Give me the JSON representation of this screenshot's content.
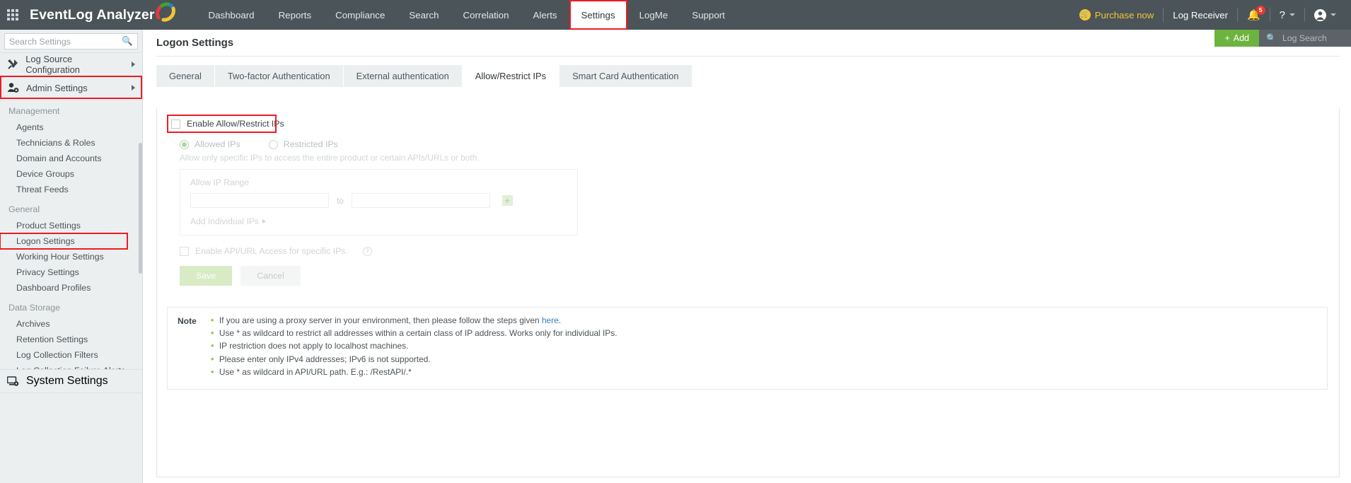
{
  "topbar": {
    "brand": "EventLog Analyzer",
    "apps_icon": "grid-apps-icon",
    "nav": [
      {
        "label": "Dashboard",
        "active": false
      },
      {
        "label": "Reports",
        "active": false
      },
      {
        "label": "Compliance",
        "active": false
      },
      {
        "label": "Search",
        "active": false
      },
      {
        "label": "Correlation",
        "active": false
      },
      {
        "label": "Alerts",
        "active": false
      },
      {
        "label": "Settings",
        "active": true
      },
      {
        "label": "LogMe",
        "active": false
      },
      {
        "label": "Support",
        "active": false
      }
    ],
    "purchase_now": "Purchase now",
    "log_receiver": "Log Receiver",
    "notification_count": "5",
    "help_glyph": "?",
    "add_label": "Add",
    "add_plus": "+",
    "log_search_placeholder": "Log Search"
  },
  "sidebar": {
    "search_placeholder": "Search Settings",
    "search_value": "",
    "top_items": [
      {
        "label": "Log Source Configuration",
        "icon": "tools-icon",
        "highlight": false
      },
      {
        "label": "Admin Settings",
        "icon": "user-gear-icon",
        "highlight": true
      }
    ],
    "groups": [
      {
        "title": "Management",
        "items": [
          {
            "label": "Agents",
            "highlight": false
          },
          {
            "label": "Technicians & Roles",
            "highlight": false
          },
          {
            "label": "Domain and Accounts",
            "highlight": false
          },
          {
            "label": "Device Groups",
            "highlight": false
          },
          {
            "label": "Threat Feeds",
            "highlight": false
          }
        ]
      },
      {
        "title": "General",
        "items": [
          {
            "label": "Product Settings",
            "highlight": false
          },
          {
            "label": "Logon Settings",
            "highlight": true
          },
          {
            "label": "Working Hour Settings",
            "highlight": false
          },
          {
            "label": "Privacy Settings",
            "highlight": false
          },
          {
            "label": "Dashboard Profiles",
            "highlight": false
          }
        ]
      },
      {
        "title": "Data Storage",
        "items": [
          {
            "label": "Archives",
            "highlight": false
          },
          {
            "label": "Retention Settings",
            "highlight": false
          },
          {
            "label": "Log Collection Filters",
            "highlight": false
          },
          {
            "label": "Log Collection Failure Alerts",
            "highlight": false
          }
        ]
      }
    ],
    "bottom_item": {
      "label": "System Settings",
      "icon": "monitor-gear-icon"
    }
  },
  "main": {
    "page_title": "Logon Settings",
    "tabs": [
      {
        "label": "General",
        "active": false
      },
      {
        "label": "Two-factor Authentication",
        "active": false
      },
      {
        "label": "External authentication",
        "active": false
      },
      {
        "label": "Allow/Restrict IPs",
        "active": true
      },
      {
        "label": "Smart Card Authentication",
        "active": false
      }
    ],
    "enable_checkbox_label": "Enable Allow/Restrict IPs",
    "enable_checked": false,
    "radios": [
      {
        "label": "Allowed IPs",
        "selected": true
      },
      {
        "label": "Restricted IPs",
        "selected": false
      }
    ],
    "helper_text": "Allow only specific IPs to access the entire product or certain APIs/URLs or both.",
    "range_card": {
      "label": "Allow IP Range",
      "from_value": "",
      "to_separator": "to",
      "to_value": "",
      "add_button_glyph": "+",
      "add_individual_label": "Add Individual IPs"
    },
    "api_access": {
      "label": "Enable API/URL Access for specific IPs.",
      "checked": false,
      "help_glyph": "?"
    },
    "save_label": "Save",
    "cancel_label": "Cancel",
    "note": {
      "title": "Note",
      "items_pre": [
        "If you are using a proxy server in your environment, then please follow the steps given ",
        "Use * as wildcard to restrict all addresses within a certain class of IP address. Works only for individual IPs.",
        "IP restriction does not apply to localhost machines.",
        "Please enter only IPv4 addresses; IPv6 is not supported.",
        "Use * as wildcard in API/URL path. E.g.: /RestAPI/.*"
      ],
      "link_text": "here",
      "link_suffix": "."
    }
  },
  "colors": {
    "topbar_bg": "#4a5459",
    "accent_red": "#ee1c25",
    "accent_green": "#6db33f",
    "accent_yellow": "#f5c431",
    "link_blue": "#2f7fc1"
  }
}
